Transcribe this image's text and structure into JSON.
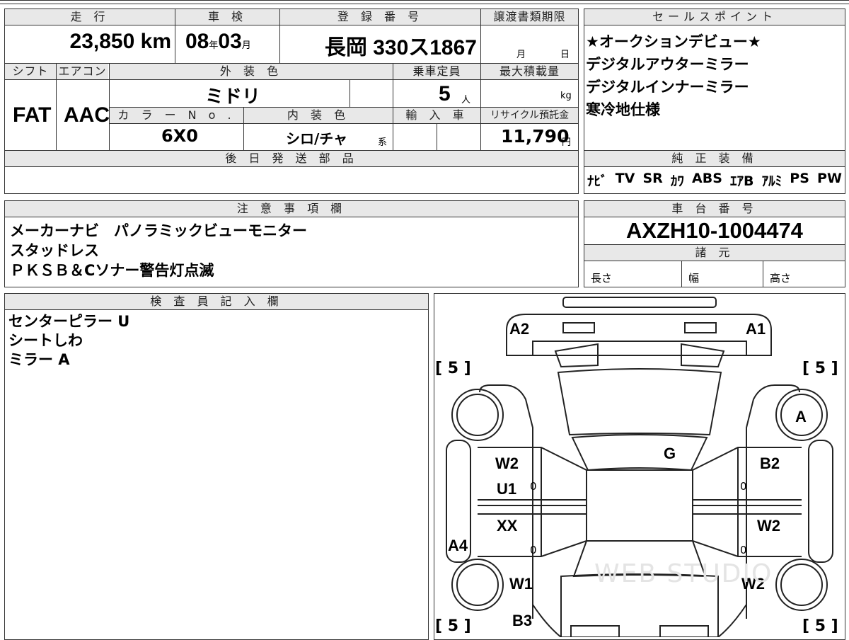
{
  "top_row_fragments": [
    "",
    "",
    ""
  ],
  "headers": {
    "mileage": "走 行",
    "inspection": "車 検",
    "registration": "登 録 番 号",
    "transfer_deadline": "譲渡書類期限",
    "shift": "シフト",
    "aircon": "エアコン",
    "exterior_color": "外 装 色",
    "capacity": "乗車定員",
    "max_load": "最大積載量",
    "color_no": "カ ラ ー N o .",
    "interior_color": "内 装 色",
    "import": "輸 入 車",
    "recycle": "リサイクル預託金",
    "later_parts": "後 日 発 送 部 品",
    "sales_points": "セールスポイント",
    "genuine_equipment": "純 正 装 備",
    "notes": "注 意 事 項 欄",
    "chassis_no": "車 台 番 号",
    "specs": "諸 元",
    "inspector": "検 査 員 記 入 欄"
  },
  "vehicle": {
    "mileage": "23,850",
    "mileage_unit": "km",
    "inspection_year": "08",
    "year_unit": "年",
    "inspection_month": "03",
    "month_unit": "月",
    "registration": "長岡 330ス1867",
    "transfer_month": "月",
    "transfer_day": "日",
    "shift": "FAT",
    "aircon": "AAC",
    "exterior_color": "ミドリ",
    "capacity": "5",
    "capacity_unit": "人",
    "max_load_unit": "kg",
    "color_no": "6X0",
    "interior_color": "シロ/チャ",
    "interior_suffix": "系",
    "recycle_fee": "11,790",
    "recycle_unit": "円",
    "chassis_no": "AXZH10-1004474",
    "spec_length": "長さ",
    "spec_width": "幅",
    "spec_height": "高さ"
  },
  "sales_points": [
    "★オークションデビュー★",
    "デジタルアウターミラー",
    "デジタルインナーミラー",
    "寒冷地仕様"
  ],
  "equipment": [
    "ﾅﾋﾞ",
    "TV",
    "SR",
    "ｶﾜ",
    "ABS",
    "ｴｱB",
    "ｱﾙﾐ",
    "PS",
    "PW"
  ],
  "notes": [
    "メーカーナビ　パノラミックビューモニター",
    "スタッドレス",
    "ＰＫＳＢ＆Cソナー警告灯点滅"
  ],
  "inspector_notes": [
    "センターピラー U",
    "シートしわ",
    "ミラー A"
  ],
  "diagram": {
    "labels": {
      "a2": "A2",
      "a1": "A1",
      "a": "A",
      "g": "G",
      "w2_left": "W2",
      "u1": "U1",
      "b2": "B2",
      "xx": "XX",
      "w2_right": "W2",
      "a4": "A4",
      "w1": "W1",
      "w2_rear": "W2",
      "b3": "B3"
    },
    "tire_tl": "[ 5 ]",
    "tire_tr": "[ 5 ]",
    "tire_bl": "[ 5 ]",
    "tire_br": "[ 5 ]",
    "zeros": [
      "0",
      "0",
      "0",
      "0"
    ],
    "watermark": "WEB STUDIO"
  }
}
